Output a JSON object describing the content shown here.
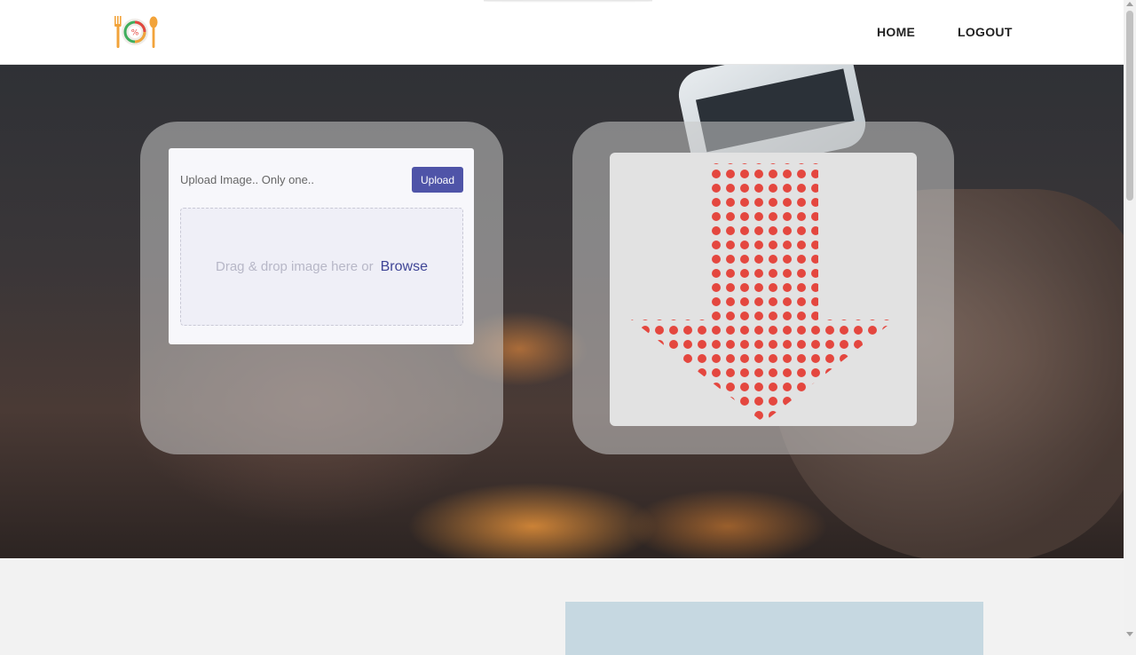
{
  "header": {
    "logo_icon": "plate-fork-spoon-logo-icon",
    "nav": {
      "home_label": "HOME",
      "logout_label": "LOGOUT"
    }
  },
  "upload": {
    "label": "Upload Image.. Only one..",
    "button_label": "Upload",
    "dropzone_text": "Drag & drop image here or",
    "browse_label": "Browse"
  },
  "result": {
    "arrow_icon": "down-arrow-dotted-icon",
    "arrow_color": "#e4473f"
  },
  "colors": {
    "accent": "#4f54a8",
    "header_bg": "#ffffff",
    "page_bg": "#f2f2f2"
  }
}
